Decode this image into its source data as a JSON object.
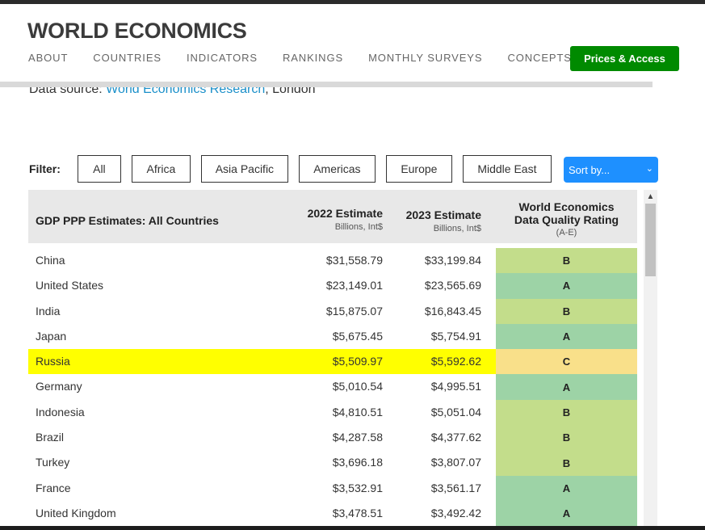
{
  "site": {
    "logo": "WORLD ECONOMICS",
    "nav": [
      "ABOUT",
      "COUNTRIES",
      "INDICATORS",
      "RANKINGS",
      "MONTHLY SURVEYS",
      "CONCEPTS"
    ],
    "cta": "Prices & Access"
  },
  "source": {
    "prefix": "Data source: ",
    "link": "World Economics Research",
    "suffix": ", London"
  },
  "filter": {
    "label": "Filter:",
    "buttons": [
      "All",
      "Africa",
      "Asia Pacific",
      "Americas",
      "Europe",
      "Middle East"
    ],
    "sort_label": "Sort by...",
    "sort_icon": "chevron-down-icon"
  },
  "table": {
    "title": "GDP PPP Estimates: All Countries",
    "col_2022": "2022 Estimate",
    "col_2022_sub": "Billions, Int$",
    "col_2023": "2023 Estimate",
    "col_2023_sub": "Billions, Int$",
    "col_rating_1": "World Economics",
    "col_rating_2": "Data Quality Rating",
    "col_rating_sub": "(A-E)",
    "rows": [
      {
        "country": "China",
        "v2022": "$31,558.79",
        "v2023": "$33,199.84",
        "rating": "B"
      },
      {
        "country": "United States",
        "v2022": "$23,149.01",
        "v2023": "$23,565.69",
        "rating": "A"
      },
      {
        "country": "India",
        "v2022": "$15,875.07",
        "v2023": "$16,843.45",
        "rating": "B"
      },
      {
        "country": "Japan",
        "v2022": "$5,675.45",
        "v2023": "$5,754.91",
        "rating": "A"
      },
      {
        "country": "Russia",
        "v2022": "$5,509.97",
        "v2023": "$5,592.62",
        "rating": "C",
        "highlighted": true
      },
      {
        "country": "Germany",
        "v2022": "$5,010.54",
        "v2023": "$4,995.51",
        "rating": "A"
      },
      {
        "country": "Indonesia",
        "v2022": "$4,810.51",
        "v2023": "$5,051.04",
        "rating": "B"
      },
      {
        "country": "Brazil",
        "v2022": "$4,287.58",
        "v2023": "$4,377.62",
        "rating": "B"
      },
      {
        "country": "Turkey",
        "v2022": "$3,696.18",
        "v2023": "$3,807.07",
        "rating": "B"
      },
      {
        "country": "France",
        "v2022": "$3,532.91",
        "v2023": "$3,561.17",
        "rating": "A"
      },
      {
        "country": "United Kingdom",
        "v2022": "$3,478.51",
        "v2023": "$3,492.42",
        "rating": "A"
      }
    ]
  },
  "colors": {
    "cta": "#008a00",
    "sort": "#1e90ff",
    "link": "#1a8fc9",
    "highlight": "#ffff00",
    "rating_A": "#9dd3a6",
    "rating_B": "#c3dd8b",
    "rating_C": "#f9e08a"
  },
  "scroll_icon": "chevron-up-icon"
}
